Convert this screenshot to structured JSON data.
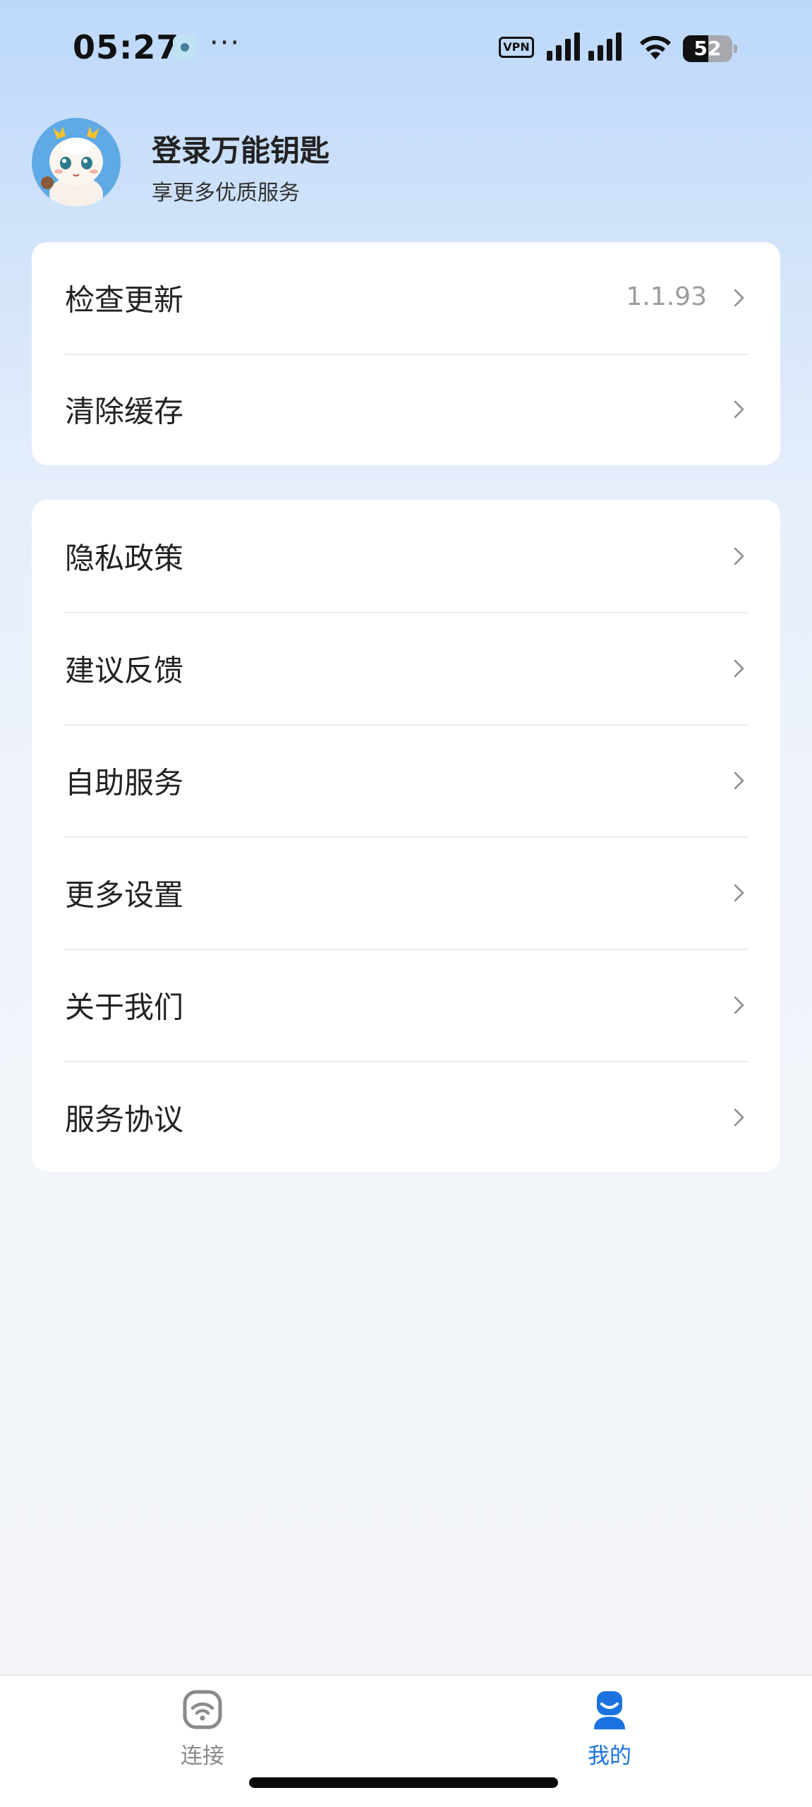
{
  "status_bar": {
    "time": "05:27",
    "more": "···",
    "vpn": "VPN",
    "battery_level": 52,
    "battery_text": "52"
  },
  "profile": {
    "title": "登录万能钥匙",
    "subtitle": "享更多优质服务"
  },
  "menu_group_1": {
    "items": [
      {
        "label": "检查更新",
        "value": "1.1.93"
      },
      {
        "label": "清除缓存"
      }
    ]
  },
  "menu_group_2": {
    "items": [
      {
        "label": "隐私政策"
      },
      {
        "label": "建议反馈"
      },
      {
        "label": "自助服务"
      },
      {
        "label": "更多设置"
      },
      {
        "label": "关于我们"
      },
      {
        "label": "服务协议"
      }
    ]
  },
  "bottom_nav": {
    "items": [
      {
        "label": "连接",
        "icon": "wifi-shield-icon",
        "active": false
      },
      {
        "label": "我的",
        "icon": "person-icon",
        "active": true
      }
    ]
  },
  "colors": {
    "accent": "#1a73e0",
    "inactive": "#8a8a8a",
    "card_bg": "#ffffff",
    "page_gradient_top": "#bcd8fb",
    "page_gradient_bottom": "#f3f5f9"
  }
}
